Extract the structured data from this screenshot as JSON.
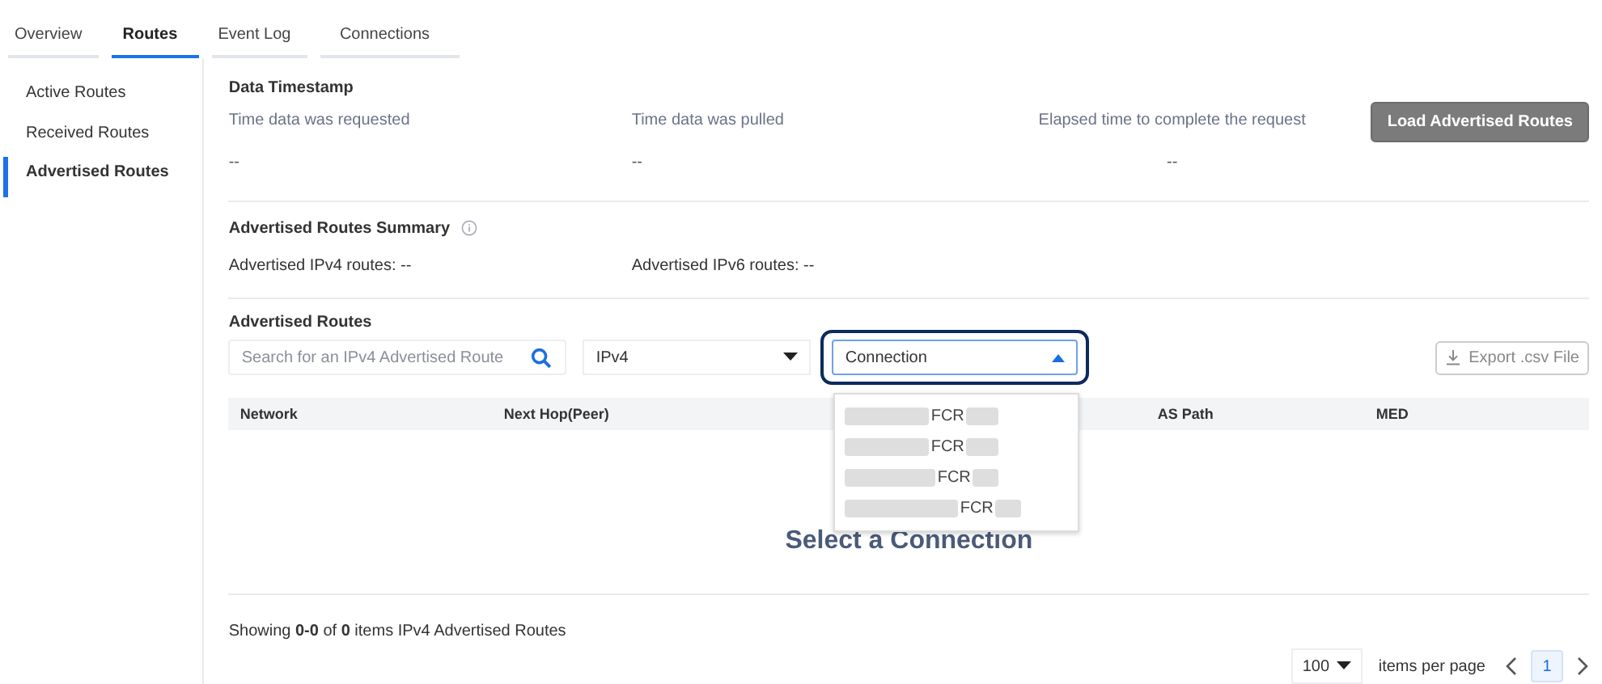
{
  "tabs": [
    {
      "label": "Overview",
      "selected": false
    },
    {
      "label": "Routes",
      "selected": true
    },
    {
      "label": "Event Log",
      "selected": false
    },
    {
      "label": "Connections",
      "selected": false
    }
  ],
  "sidebar": {
    "items": [
      {
        "label": "Active Routes",
        "selected": false
      },
      {
        "label": "Received Routes",
        "selected": false
      },
      {
        "label": "Advertised Routes",
        "selected": true
      }
    ]
  },
  "timestamp": {
    "title": "Data Timestamp",
    "fields": [
      {
        "label": "Time data was requested",
        "value": "--"
      },
      {
        "label": "Time data was pulled",
        "value": "--"
      },
      {
        "label": "Elapsed time to complete the request",
        "value": "--"
      }
    ],
    "button": "Load Advertised Routes"
  },
  "summary": {
    "title": "Advertised Routes Summary",
    "items": [
      "Advertised IPv4 routes: --",
      "Advertised IPv6 routes: --"
    ]
  },
  "routes": {
    "title": "Advertised Routes",
    "search": {
      "placeholder": "Search for an IPv4 Advertised Route"
    },
    "family": {
      "value": "IPv4"
    },
    "connection": {
      "value": "Connection",
      "expanded": true,
      "options": [
        "FCR",
        "FCR",
        "FCR",
        "FCR"
      ]
    },
    "export_button": "Export .csv File",
    "columns": [
      "Network",
      "Next Hop(Peer)",
      "AS Path",
      "MED"
    ],
    "empty_message": "Select a Connection"
  },
  "footer": {
    "showing": "Showing **0-0** of **0** items IPv4 Advertised Routes",
    "per_page": "100",
    "per_page_label": "items per page",
    "pages": [
      {
        "label": "1",
        "selected": true
      }
    ]
  }
}
